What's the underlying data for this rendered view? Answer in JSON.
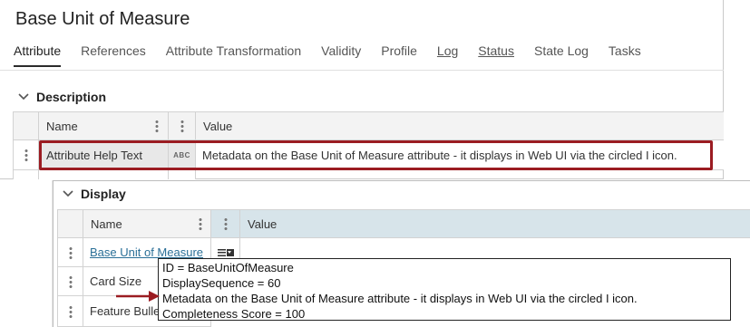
{
  "header": {
    "title": "Base Unit of Measure"
  },
  "tabs": [
    {
      "label": "Attribute"
    },
    {
      "label": "References"
    },
    {
      "label": "Attribute Transformation"
    },
    {
      "label": "Validity"
    },
    {
      "label": "Profile"
    },
    {
      "label": "Log"
    },
    {
      "label": "Status"
    },
    {
      "label": "State Log"
    },
    {
      "label": "Tasks"
    }
  ],
  "description": {
    "title": "Description",
    "columns": {
      "name": "Name",
      "value": "Value"
    },
    "row": {
      "name": "Attribute Help Text",
      "type_icon": "ABC",
      "value": "Metadata on the Base Unit of Measure attribute - it displays in Web UI via the circled I icon."
    }
  },
  "display": {
    "title": "Display",
    "columns": {
      "name": "Name",
      "value": "Value"
    },
    "rows": [
      {
        "name": "Base Unit of Measure"
      },
      {
        "name": "Card Size"
      },
      {
        "name": "Feature Bulle"
      }
    ]
  },
  "tooltip": {
    "lines": [
      "ID = BaseUnitOfMeasure",
      "DisplaySequence = 60",
      "Metadata on the Base Unit of Measure attribute - it displays in Web UI via the circled I icon.",
      "Completeness Score = 100"
    ]
  },
  "colors": {
    "highlight": "#9b1c22",
    "link": "#2a6f97",
    "header_teal": "#d7e4ea"
  },
  "icons": [
    "chevron-down-icon",
    "more-vertical-icon",
    "abc-text-icon",
    "list-dropdown-icon",
    "arrow-right-icon"
  ]
}
